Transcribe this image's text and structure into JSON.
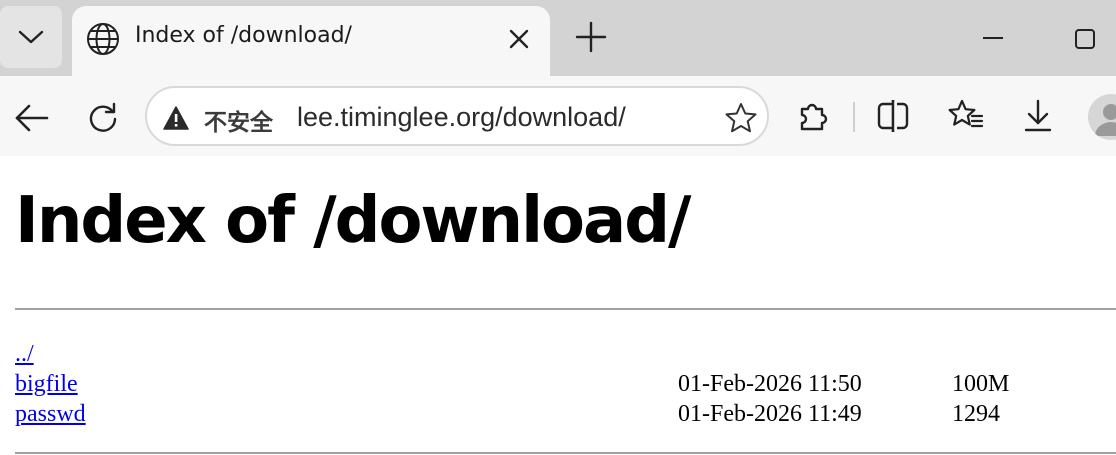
{
  "tab": {
    "title": "Index of /download/"
  },
  "omnibox": {
    "security_label": "不安全",
    "url": "lee.timinglee.org/download/"
  },
  "icons": {
    "tab_list": "chevron-down-icon",
    "tab_favicon": "globe-icon",
    "tab_close": "close-icon",
    "new_tab": "plus-icon",
    "minimize": "minimize-icon",
    "maximize": "maximize-icon",
    "back": "arrow-left-icon",
    "reload": "reload-icon",
    "security": "warning-triangle-icon",
    "favorite": "star-icon",
    "extensions": "puzzle-icon",
    "split_screen": "split-screen-icon",
    "favorites": "favorites-list-icon",
    "downloads": "download-icon",
    "profile": "avatar-icon"
  },
  "page": {
    "title": "Index of /download/",
    "entries": [
      {
        "name": "../",
        "mtime": "",
        "size": ""
      },
      {
        "name": "bigfile",
        "mtime": "01-Feb-2026 11:50",
        "size": "100M"
      },
      {
        "name": "passwd",
        "mtime": "01-Feb-2026 11:49",
        "size": "1294"
      }
    ]
  },
  "colors": {
    "link": "#0000ee",
    "tabstrip_bg": "#d3d3d3",
    "toolbar_bg": "#f7f7f7"
  }
}
